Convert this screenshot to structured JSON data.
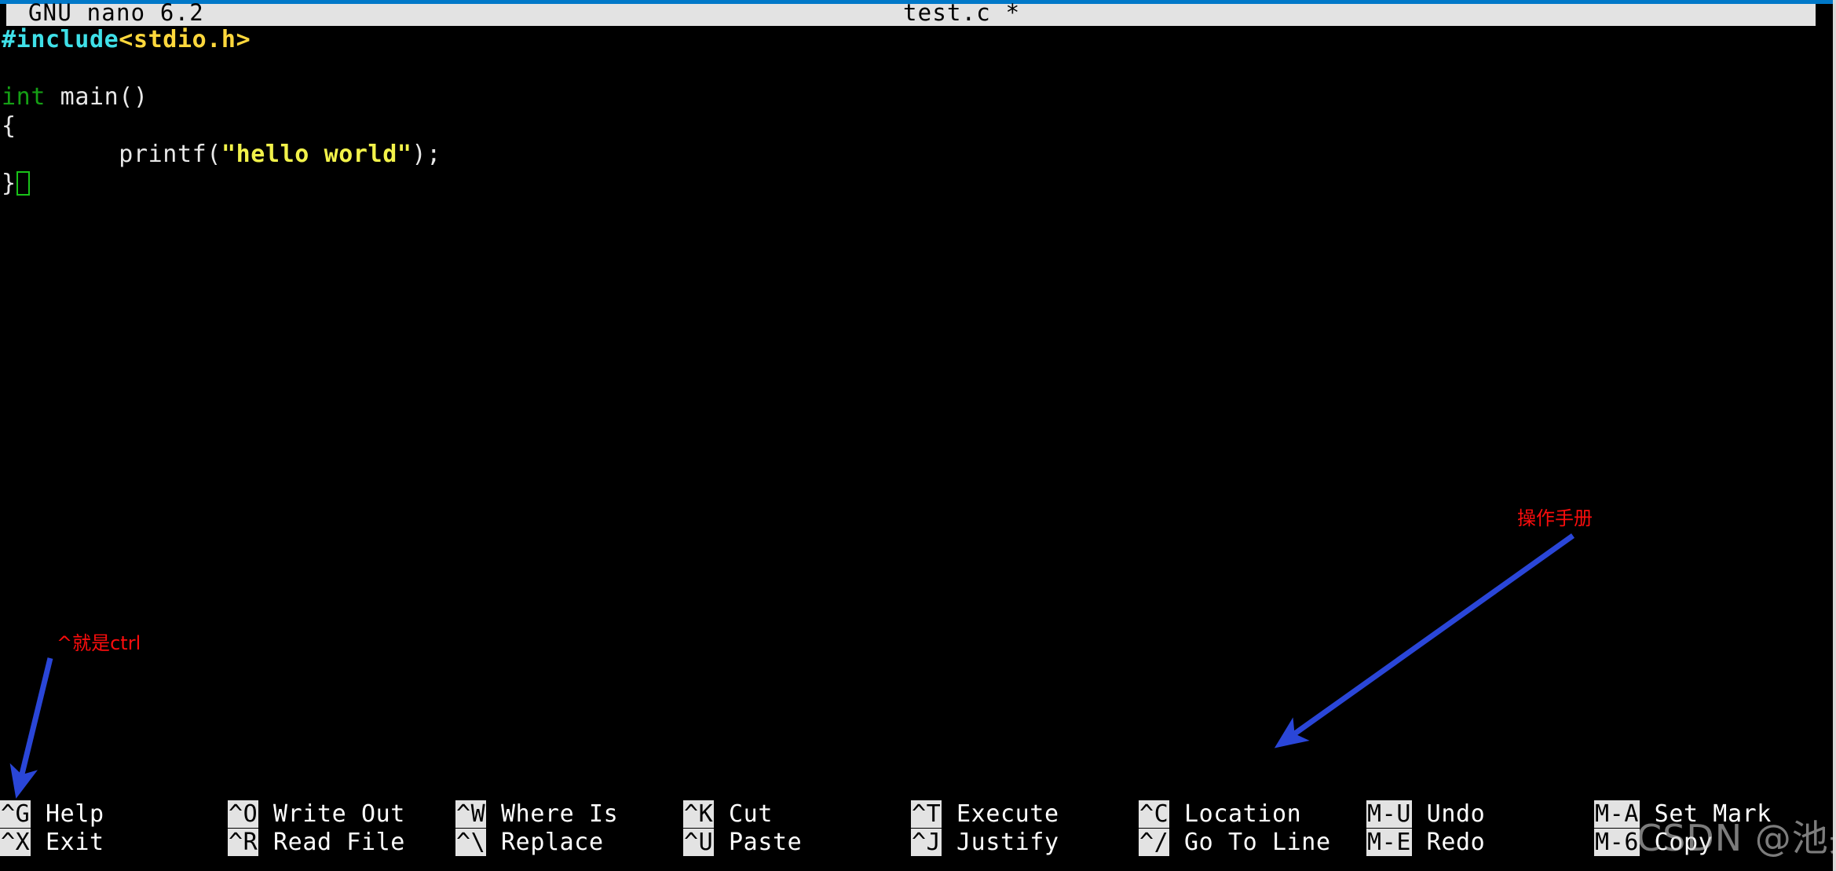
{
  "app": {
    "titlebar": {
      "version_label": "GNU nano 6.2",
      "filename_label": "test.c *"
    }
  },
  "editor": {
    "lines": [
      {
        "segments": [
          {
            "text": "#include",
            "style": "pp"
          },
          {
            "text": "<stdio.h>",
            "style": "hdr"
          }
        ]
      },
      {
        "segments": []
      },
      {
        "segments": [
          {
            "text": "int",
            "style": "type"
          },
          {
            "text": " main()",
            "style": "plain"
          }
        ]
      },
      {
        "segments": [
          {
            "text": "{",
            "style": "plain"
          }
        ]
      },
      {
        "segments": [
          {
            "text": "        printf(",
            "style": "plain"
          },
          {
            "text": "\"hello world\"",
            "style": "str"
          },
          {
            "text": ");",
            "style": "plain"
          }
        ]
      },
      {
        "segments": [
          {
            "text": "}",
            "style": "plain"
          }
        ],
        "cursor": true
      }
    ],
    "raw_text": "#include<stdio.h>\n\nint main()\n{\n        printf(\"hello world\");\n}",
    "cursor_position": "after closing brace on line 6"
  },
  "shortcuts": {
    "columns": [
      {
        "top": {
          "key": "^G",
          "label": " Help"
        },
        "bottom": {
          "key": "^X",
          "label": " Exit"
        }
      },
      {
        "top": {
          "key": "^O",
          "label": " Write Out"
        },
        "bottom": {
          "key": "^R",
          "label": " Read File"
        }
      },
      {
        "top": {
          "key": "^W",
          "label": " Where Is"
        },
        "bottom": {
          "key": "^\\",
          "label": " Replace"
        }
      },
      {
        "top": {
          "key": "^K",
          "label": " Cut"
        },
        "bottom": {
          "key": "^U",
          "label": " Paste"
        }
      },
      {
        "top": {
          "key": "^T",
          "label": " Execute"
        },
        "bottom": {
          "key": "^J",
          "label": " Justify"
        }
      },
      {
        "top": {
          "key": "^C",
          "label": " Location"
        },
        "bottom": {
          "key": "^/",
          "label": " Go To Line"
        }
      },
      {
        "top": {
          "key": "M-U",
          "label": " Undo"
        },
        "bottom": {
          "key": "M-E",
          "label": " Redo"
        }
      },
      {
        "top": {
          "key": "M-A",
          "label": " Set Mark"
        },
        "bottom": {
          "key": "M-6",
          "label": " Copy"
        }
      }
    ]
  },
  "annotations": {
    "ctrl_note": "^就是ctrl",
    "manual_note": "操作手册",
    "arrow_color": "#2a46d8",
    "text_color": "#fb0d0d"
  },
  "watermark": {
    "text": "CSDN @池央"
  },
  "colors": {
    "background": "#000000",
    "titlebar_bg": "#e3e3e3",
    "titlebar_fg": "#000000",
    "preprocessor": "#3fe0e8",
    "header_name": "#ffd83c",
    "keyword_type": "#15a015",
    "string_literal": "#f2f24a",
    "plain_text": "#e8e8e8",
    "cursor_outline": "#19c219",
    "top_accent": "#0078c8"
  }
}
